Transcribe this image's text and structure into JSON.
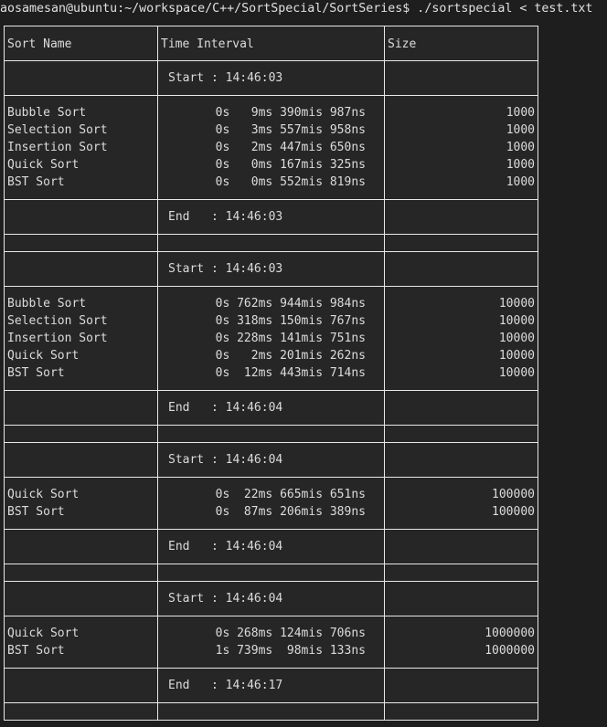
{
  "terminal": {
    "prompt": "aosamesan@ubuntu:~/workspace/C++/SortSpecial/SortSeries$ ./sortspecial < test.txt"
  },
  "table": {
    "headers": [
      "Sort Name",
      "Time Interval",
      "Size"
    ],
    "groups": [
      {
        "start": "Start : 14:46:03",
        "end": "End   : 14:46:03",
        "rows": [
          {
            "name": "Bubble Sort",
            "time": "0s   9ms 390mis 987ns",
            "size": "1000"
          },
          {
            "name": "Selection Sort",
            "time": "0s   3ms 557mis 958ns",
            "size": "1000"
          },
          {
            "name": "Insertion Sort",
            "time": "0s   2ms 447mis 650ns",
            "size": "1000"
          },
          {
            "name": "Quick Sort",
            "time": "0s   0ms 167mis 325ns",
            "size": "1000"
          },
          {
            "name": "BST Sort",
            "time": "0s   0ms 552mis 819ns",
            "size": "1000"
          }
        ]
      },
      {
        "start": "Start : 14:46:03",
        "end": "End   : 14:46:04",
        "rows": [
          {
            "name": "Bubble Sort",
            "time": "0s 762ms 944mis 984ns",
            "size": "10000"
          },
          {
            "name": "Selection Sort",
            "time": "0s 318ms 150mis 767ns",
            "size": "10000"
          },
          {
            "name": "Insertion Sort",
            "time": "0s 228ms 141mis 751ns",
            "size": "10000"
          },
          {
            "name": "Quick Sort",
            "time": "0s   2ms 201mis 262ns",
            "size": "10000"
          },
          {
            "name": "BST Sort",
            "time": "0s  12ms 443mis 714ns",
            "size": "10000"
          }
        ]
      },
      {
        "start": "Start : 14:46:04",
        "end": "End   : 14:46:04",
        "rows": [
          {
            "name": "Quick Sort",
            "time": "0s  22ms 665mis 651ns",
            "size": "100000"
          },
          {
            "name": "BST Sort",
            "time": "0s  87ms 206mis 389ns",
            "size": "100000"
          }
        ]
      },
      {
        "start": "Start : 14:46:04",
        "end": "End   : 14:46:17",
        "rows": [
          {
            "name": "Quick Sort",
            "time": "0s 268ms 124mis 706ns",
            "size": "1000000"
          },
          {
            "name": "BST Sort",
            "time": "1s 739ms  98mis 133ns",
            "size": "1000000"
          }
        ]
      }
    ]
  }
}
